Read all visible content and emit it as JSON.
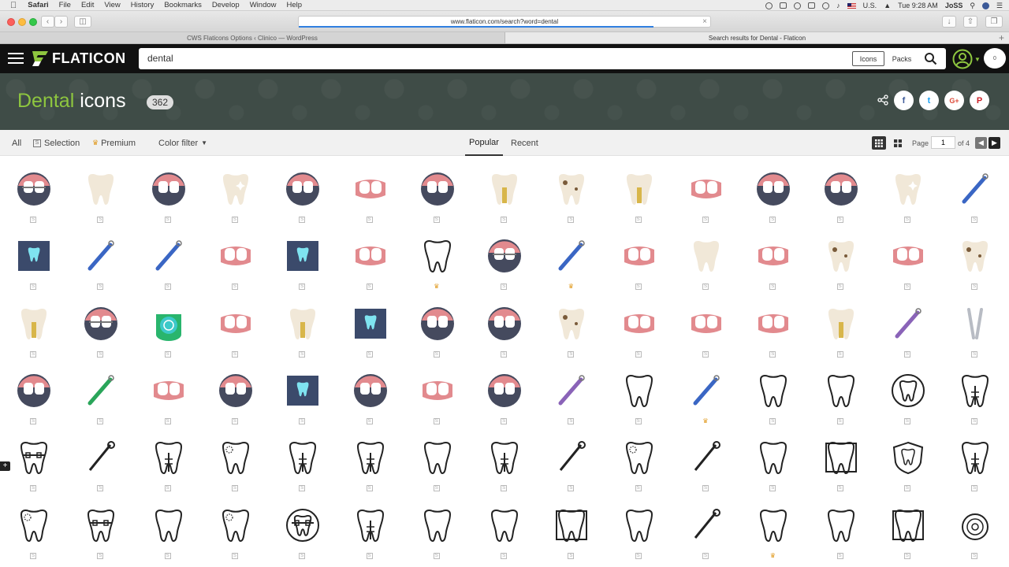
{
  "menubar": {
    "app": "Safari",
    "items": [
      "File",
      "Edit",
      "View",
      "History",
      "Bookmarks",
      "Develop",
      "Window",
      "Help"
    ],
    "locale": "U.S.",
    "clock": "Tue 9:28 AM",
    "user": "JoSS"
  },
  "browser": {
    "url": "www.flaticon.com/search?word=dental",
    "tabs": [
      "CWS Flaticons Options ‹ Clinico — WordPress",
      "Search results for Dental - Flaticon"
    ]
  },
  "header": {
    "logo": "FLATICON",
    "search_value": "dental",
    "seg_icons": "Icons",
    "seg_packs": "Packs",
    "notifications": "0"
  },
  "hero": {
    "keyword": "Dental",
    "suffix": "icons",
    "count": "362",
    "social": [
      "f",
      "t",
      "G+",
      "P"
    ]
  },
  "filters": {
    "all": "All",
    "selection": "Selection",
    "premium": "Premium",
    "color_filter": "Color filter",
    "popular": "Popular",
    "recent": "Recent",
    "page_label": "Page",
    "page_value": "1",
    "page_of": "of 4"
  },
  "colors": {
    "accent": "#8ec63f",
    "header_bg": "#111111",
    "hero_bg": "#3f4c47",
    "tooth": "#f1e8d8",
    "gum": "#e28a8e",
    "navy": "#454a5e"
  },
  "icon_rows": [
    [
      "braces-circle-icon",
      "molar-tooth-icon",
      "tooth-brush-circle-icon",
      "shiny-tooth-icon",
      "teeth-circle-icon",
      "dental-drill-gum-icon",
      "implant-circle-icon",
      "dental-implant-icon",
      "decayed-tooth-icon",
      "tooth-implant-root-icon",
      "gum-dotted-tooth-icon",
      "broken-tooth-circle-icon",
      "front-teeth-circle-icon",
      "shiny-molar-icon",
      "dental-drill-icon"
    ],
    [
      "xray-screen-icon",
      "electric-toothbrush-icon",
      "tooth-scalpel-icon",
      "gum-implant-icon",
      "tooth-xray-icon",
      "gum-tooth-icon",
      "tooth-cross-outline-icon",
      "braces-circle-icon",
      "scalpel-line-icon",
      "veneer-icon",
      "braces-tooth-icon",
      "teeth-gum-icon",
      "decayed-tooth-icon",
      "teeth-gum-icon",
      "molar-spot-icon"
    ],
    [
      "implant-column-icon",
      "braces-circle-icon",
      "dental-floss-icon",
      "teeth-pink-gum-icon",
      "implant-screw-icon",
      "xray-film-icon",
      "teeth-circle-icon",
      "teeth-circle-icon",
      "decayed-molar-icon",
      "teeth-gum-icon",
      "gum-tooth-icon",
      "teeth-gum-icon",
      "implant-crown-icon",
      "dental-probe-icon",
      "extraction-forceps-icon"
    ],
    [
      "tooth-circle-icon",
      "dental-mirror-icon",
      "teeth-pink-gum-icon",
      "teeth-circle-icon",
      "tooth-xray-icon",
      "tooth-circle-icon",
      "teeth-gum-icon",
      "teeth-circle-icon",
      "dental-probe-icon",
      "tooth-outline-icon",
      "scalpel-line-icon",
      "sparkle-tooth-outline-icon",
      "tooth-outline-icon",
      "tooth-circle-outline-icon",
      "implant-outline-icon"
    ],
    [
      "braces-outline-icon",
      "drill-tooth-outline-icon",
      "implant-crown-outline-icon",
      "decayed-tooth-outline-icon",
      "root-canal-outline-icon",
      "tooth-screw-outline-icon",
      "tooth-outline-icon",
      "implant-screw-outline-icon",
      "dental-drill-outline-icon",
      "dotted-tooth-outline-icon",
      "toothbrush-outline-icon",
      "tooth-mirror-outline-icon",
      "xray-chart-outline-icon",
      "tooth-shield-outline-icon",
      "crown-implant-outline-icon"
    ],
    [
      "decayed-tooth-outline-icon",
      "braces-shield-outline-icon",
      "front-teeth-outline-icon",
      "dotted-gum-outline-icon",
      "braces-circle-outline-icon",
      "teeth-implant-outline-icon",
      "sad-tooth-outline-icon",
      "teeth-gum-outline-icon",
      "xray-tooth-outline-icon",
      "tooth-face-outline-icon",
      "forceps-outline-icon",
      "tooth-outline-icon",
      "gum-tooth-outline-icon",
      "tooth-frame-outline-icon",
      "floss-outline-icon"
    ]
  ],
  "premium_cells": [
    "1-6",
    "1-8",
    "3-10",
    "5-11"
  ],
  "selection_glyph": "S",
  "premium_glyph": "♛"
}
